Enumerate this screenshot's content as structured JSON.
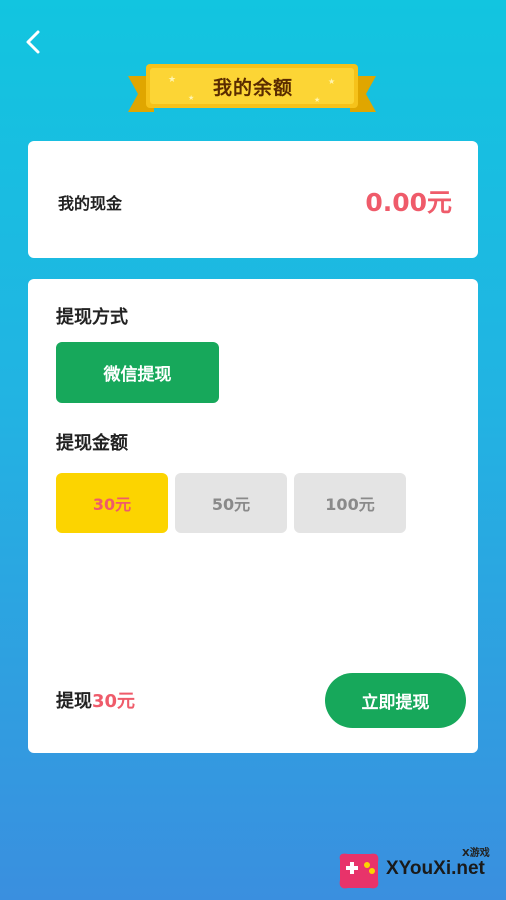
{
  "header": {
    "title": "我的余额"
  },
  "cash": {
    "label": "我的现金",
    "value": "0.00元"
  },
  "withdraw": {
    "method_title": "提现方式",
    "method_button": "微信提现",
    "amount_title": "提现金额",
    "amounts": [
      "30元",
      "50元",
      "100元"
    ],
    "selected_amount": "30元",
    "summary_prefix": "提现",
    "summary_amount": "30元",
    "submit_label": "立即提现"
  },
  "watermark": {
    "site": "XYouXi.net",
    "sub": "X游戏"
  },
  "colors": {
    "accent_red": "#ef5b6a",
    "button_green": "#17a85b",
    "selected_yellow": "#fcd400",
    "banner_gold": "#f6c21a"
  },
  "icons": {
    "back": "chevron-left-icon"
  }
}
